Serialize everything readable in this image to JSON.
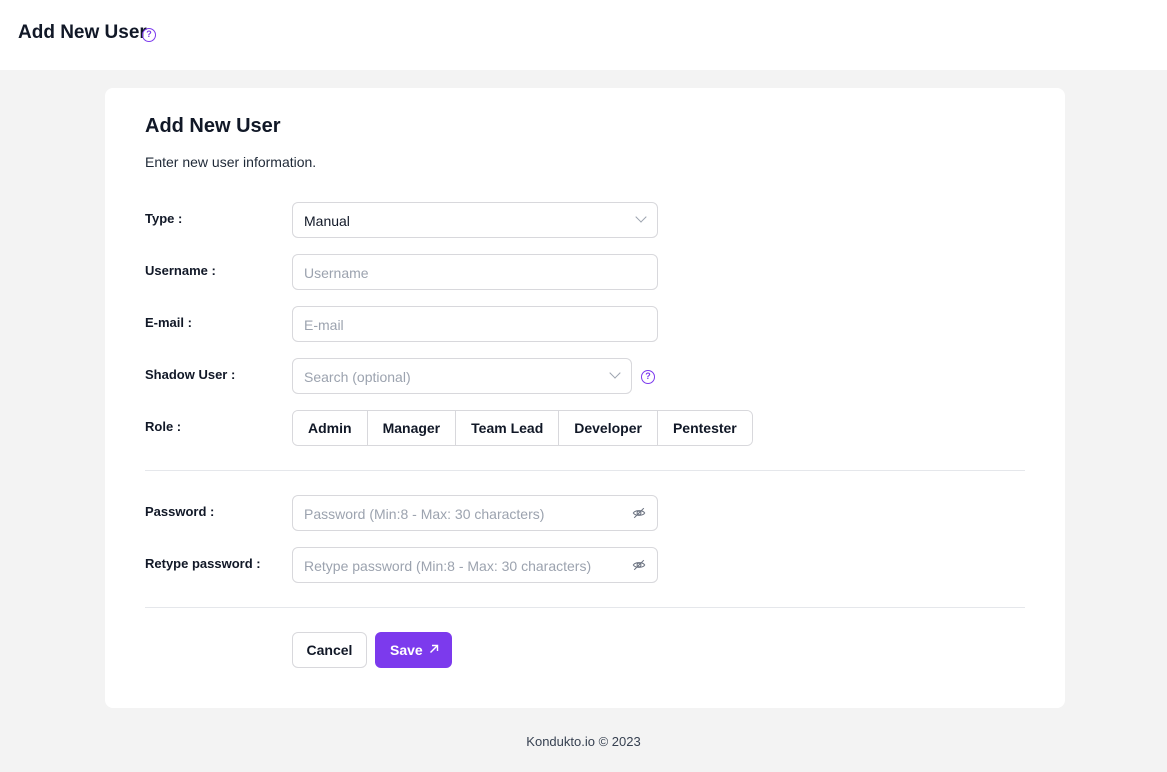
{
  "header": {
    "title": "Add New User",
    "help_icon": "question-circle-icon"
  },
  "card": {
    "title": "Add New User",
    "subtitle": "Enter new user information."
  },
  "form": {
    "type": {
      "label": "Type :",
      "value": "Manual"
    },
    "username": {
      "label": "Username :",
      "placeholder": "Username"
    },
    "email": {
      "label": "E-mail :",
      "placeholder": "E-mail"
    },
    "shadow_user": {
      "label": "Shadow User :",
      "placeholder": "Search (optional)"
    },
    "role": {
      "label": "Role :",
      "options": [
        "Admin",
        "Manager",
        "Team Lead",
        "Developer",
        "Pentester"
      ]
    },
    "password": {
      "label": "Password :",
      "placeholder": "Password (Min:8 - Max: 30 characters)"
    },
    "retype_password": {
      "label": "Retype password :",
      "placeholder": "Retype password (Min:8 - Max: 30 characters)"
    }
  },
  "actions": {
    "cancel_label": "Cancel",
    "save_label": "Save"
  },
  "footer": {
    "text": "Kondukto.io © 2023"
  },
  "colors": {
    "accent": "#7c3aed",
    "background": "#f3f3f3",
    "border": "#d8d8dc"
  }
}
